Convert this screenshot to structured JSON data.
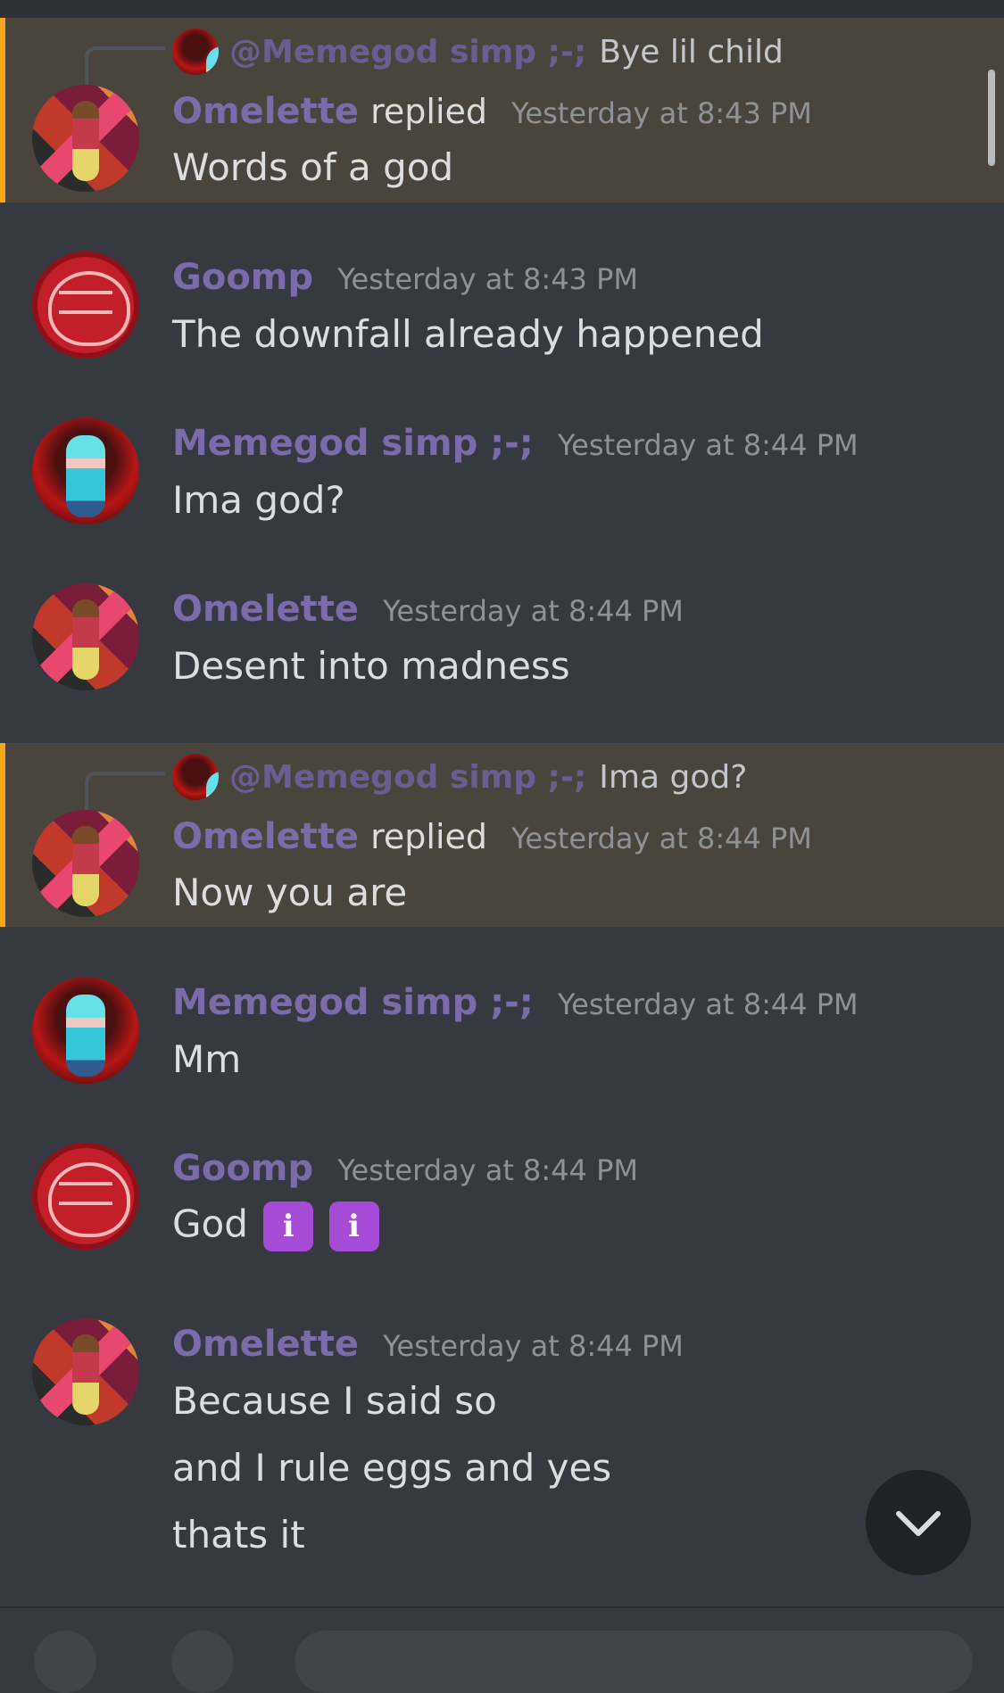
{
  "messages": [
    {
      "author": "Omelette",
      "replied_label": "replied",
      "time": "Yesterday at 8:43 PM",
      "reply_to": {
        "mention": "@Memegod simp ;-;",
        "text": "Bye lil child"
      },
      "lines": [
        "Words of a god"
      ]
    },
    {
      "author": "Goomp",
      "time": "Yesterday at 8:43 PM",
      "lines": [
        "The downfall already happened"
      ]
    },
    {
      "author": "Memegod simp ;-;",
      "time": "Yesterday at 8:44 PM",
      "lines": [
        "Ima god?"
      ]
    },
    {
      "author": "Omelette",
      "time": "Yesterday at 8:44 PM",
      "lines": [
        "Desent into madness"
      ]
    },
    {
      "author": "Omelette",
      "replied_label": "replied",
      "time": "Yesterday at 8:44 PM",
      "reply_to": {
        "mention": "@Memegod simp ;-;",
        "text": "Ima god?"
      },
      "lines": [
        "Now you are"
      ]
    },
    {
      "author": "Memegod simp ;-;",
      "time": "Yesterday at 8:44 PM",
      "lines": [
        "Mm"
      ]
    },
    {
      "author": "Goomp",
      "time": "Yesterday at 8:44 PM",
      "lines": [
        "God"
      ],
      "emojis": [
        "information-emoji",
        "information-emoji"
      ]
    },
    {
      "author": "Omelette",
      "time": "Yesterday at 8:44 PM",
      "lines": [
        "Because I said so",
        "and I rule eggs and yes",
        "thats it"
      ]
    }
  ],
  "icons": {
    "jump": "chevron-down-icon",
    "emoji_glyph": "ℹ"
  },
  "colors": {
    "background": "#36393f",
    "username": "#7c6bab",
    "highlight": "#49443c",
    "highlight_bar": "#faa61a"
  }
}
